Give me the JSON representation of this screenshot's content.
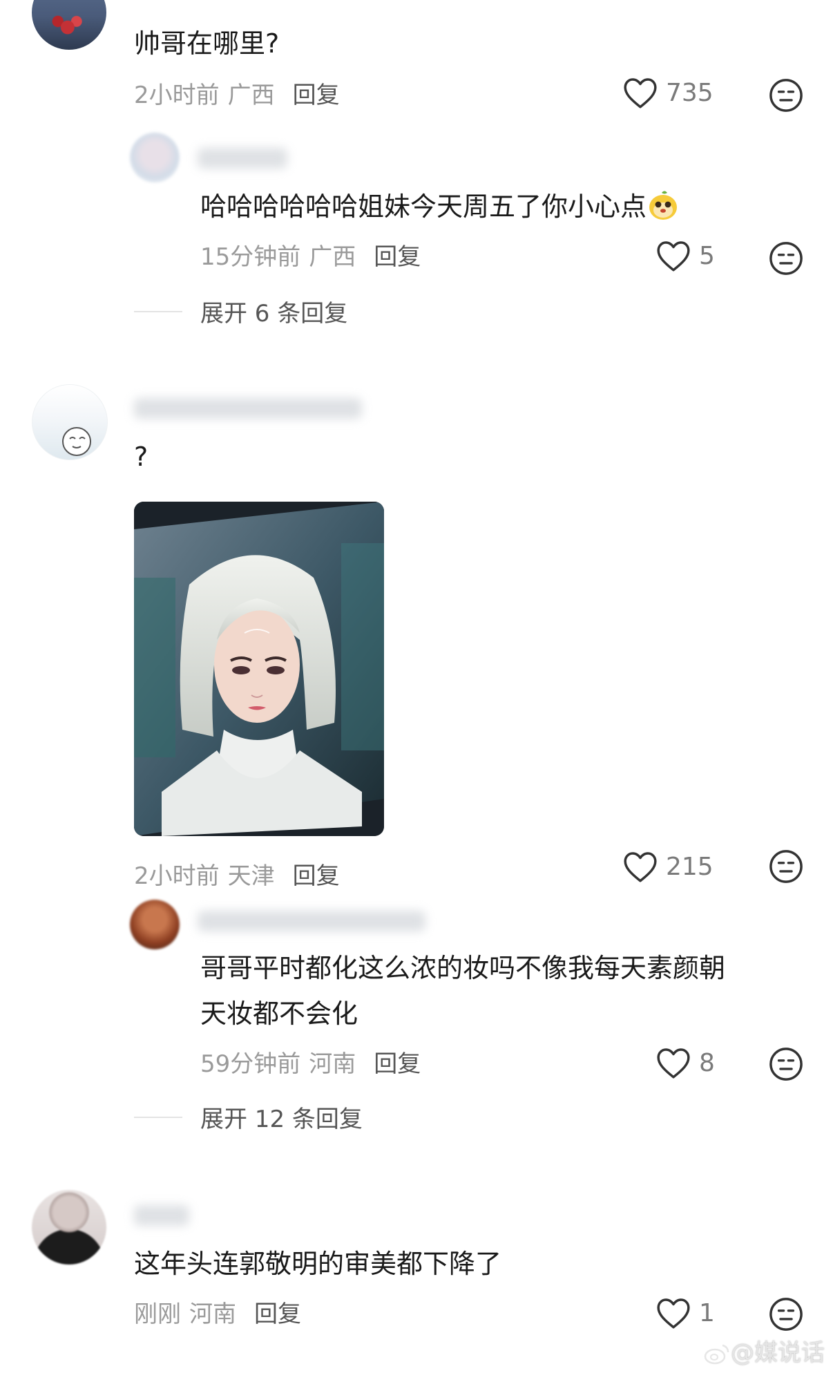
{
  "comments": [
    {
      "text": "帅哥在哪里?",
      "time": "2小时前",
      "location": "广西",
      "reply_label": "回复",
      "likes": "735",
      "reply": {
        "text": "哈哈哈哈哈哈姐妹今天周五了你小心点",
        "time": "15分钟前",
        "location": "广西",
        "reply_label": "回复",
        "likes": "5"
      },
      "expand_label": "展开 6 条回复"
    },
    {
      "text": "?",
      "time": "2小时前",
      "location": "天津",
      "reply_label": "回复",
      "likes": "215",
      "reply": {
        "text_line1": "哥哥平时都化这么浓的妆吗不像我每天素颜朝",
        "text_line2": "天妆都不会化",
        "time": "59分钟前",
        "location": "河南",
        "reply_label": "回复",
        "likes": "8"
      },
      "expand_label": "展开 12 条回复"
    },
    {
      "text": "这年头连郭敬明的审美都下降了",
      "time": "刚刚",
      "location": "河南",
      "reply_label": "回复",
      "likes": "1"
    }
  ],
  "watermark": "@媒说话",
  "icons": {
    "like": "heart-outline-icon",
    "dislike": "neutral-face-icon",
    "emoji": "mascot-emoji-icon",
    "weibo": "weibo-logo-icon"
  },
  "colors": {
    "text": "#1a1a1a",
    "meta": "#9a9a9a",
    "reply": "#555555",
    "icon": "#333333"
  }
}
